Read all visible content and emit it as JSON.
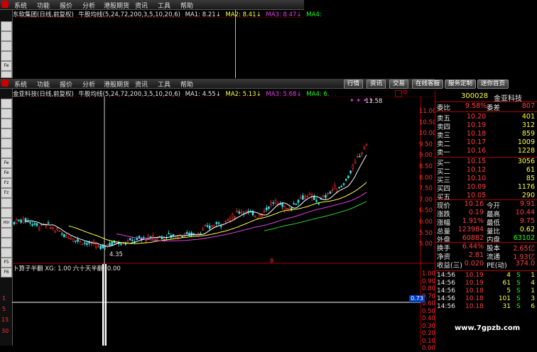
{
  "top_window": {
    "menu": [
      "系统",
      "功能",
      "报价",
      "分析",
      "港股期货",
      "资讯",
      "工具",
      "帮助"
    ],
    "stock_title": "东软集团(日线,前复权)",
    "indicator": "牛股均线(5,24,72,200,3,5,10,20,6)",
    "ma1": "MA1: 8.21",
    "ma2": "MA2: 8.41",
    "ma3": "MA3: 8.47",
    "ma4": "MA4:"
  },
  "main_window": {
    "menu": [
      "系统",
      "功能",
      "报价",
      "分析",
      "港股期货",
      "资讯",
      "工具",
      "帮助"
    ],
    "tabs": [
      "行情",
      "资讯",
      "交易",
      "在线客服",
      "服务定制",
      "迷你首页"
    ],
    "stock_title": "金亚科技(日线,前复权)",
    "indicator": "牛股均线(5,24,72,200,3,5,10,20,6)",
    "ma1": "MA1: 4.55",
    "ma2": "MA2: 5.13",
    "ma3": "MA3: 5.68",
    "ma4": "MA4: 6.",
    "high_label": "11.58",
    "low_label": "4.35",
    "sub_title": "卜算子半翻  XG: 1.00  六十天半翻: 0.00",
    "sub_value": "0.73",
    "price_axis": [
      "11.00",
      "10.50",
      "10.00",
      "9.50",
      "9.00",
      "8.50",
      "8.00",
      "7.50",
      "7.00",
      "6.50",
      "6.00",
      "5.50",
      "5.00"
    ],
    "sub_axis": [
      "1.00",
      "0.90",
      "0.80",
      "0.70",
      "0.60",
      "0.50",
      "0.40",
      "0.30",
      "0.20",
      "0.10",
      "0.00"
    ],
    "left_scale": [
      "1",
      "5",
      "15",
      "30"
    ],
    "tools": [
      "Fe",
      "Fe",
      "Fz",
      "Fz",
      "RSI",
      "F5",
      "F6"
    ]
  },
  "quote": {
    "code": "300028",
    "name": "金亚科技",
    "ratio_label": "委比",
    "ratio_value": "9.58%",
    "diff_label": "委差",
    "diff_value": "807",
    "sells": [
      {
        "label": "卖五",
        "price": "10.20",
        "vol": "401"
      },
      {
        "label": "卖四",
        "price": "10.19",
        "vol": "312"
      },
      {
        "label": "卖三",
        "price": "10.18",
        "vol": "859"
      },
      {
        "label": "卖二",
        "price": "10.17",
        "vol": "1009"
      },
      {
        "label": "卖一",
        "price": "10.16",
        "vol": "1228"
      }
    ],
    "buys": [
      {
        "label": "买一",
        "price": "10.15",
        "vol": "3056"
      },
      {
        "label": "买二",
        "price": "10.12",
        "vol": "61"
      },
      {
        "label": "买三",
        "price": "10.10",
        "vol": "85"
      },
      {
        "label": "买四",
        "price": "10.09",
        "vol": "1176"
      },
      {
        "label": "买五",
        "price": "10.05",
        "vol": "290"
      }
    ],
    "stats": [
      {
        "l1": "现价",
        "v1": "10.16",
        "l2": "今开",
        "v2": "9.91"
      },
      {
        "l1": "涨跌",
        "v1": "0.19",
        "l2": "最高",
        "v2": "10.44"
      },
      {
        "l1": "涨幅",
        "v1": "1.91%",
        "l2": "最低",
        "v2": "9.75"
      },
      {
        "l1": "总量",
        "v1": "123984",
        "l2": "量比",
        "v2": "0.62"
      },
      {
        "l1": "外盘",
        "v1": "60882",
        "l2": "内盘",
        "v2": "63102"
      }
    ],
    "stats2": [
      {
        "l1": "换手",
        "v1": "6.44%",
        "l2": "股本",
        "v2": "2.65亿"
      },
      {
        "l1": "净资",
        "v1": "2.81",
        "l2": "流通",
        "v2": "1.93亿"
      },
      {
        "l1": "收益(三)",
        "v1": "0.020",
        "l2": "PE(动)",
        "v2": "374.0"
      }
    ],
    "ticks": [
      {
        "t": "14:56",
        "p": "10.19",
        "v": "4",
        "s": "S",
        "n": "1"
      },
      {
        "t": "14:56",
        "p": "10.19",
        "v": "61",
        "s": "S",
        "n": "4"
      },
      {
        "t": "14:56",
        "p": "10.18",
        "v": "5",
        "s": "S",
        "n": "1"
      },
      {
        "t": "14:56",
        "p": "10.18",
        "v": "101",
        "s": "S",
        "n": "3"
      },
      {
        "t": "14:56",
        "p": "10.18",
        "v": "31",
        "s": "S",
        "n": "6"
      }
    ]
  },
  "watermark": "www.7gpzb.com"
}
